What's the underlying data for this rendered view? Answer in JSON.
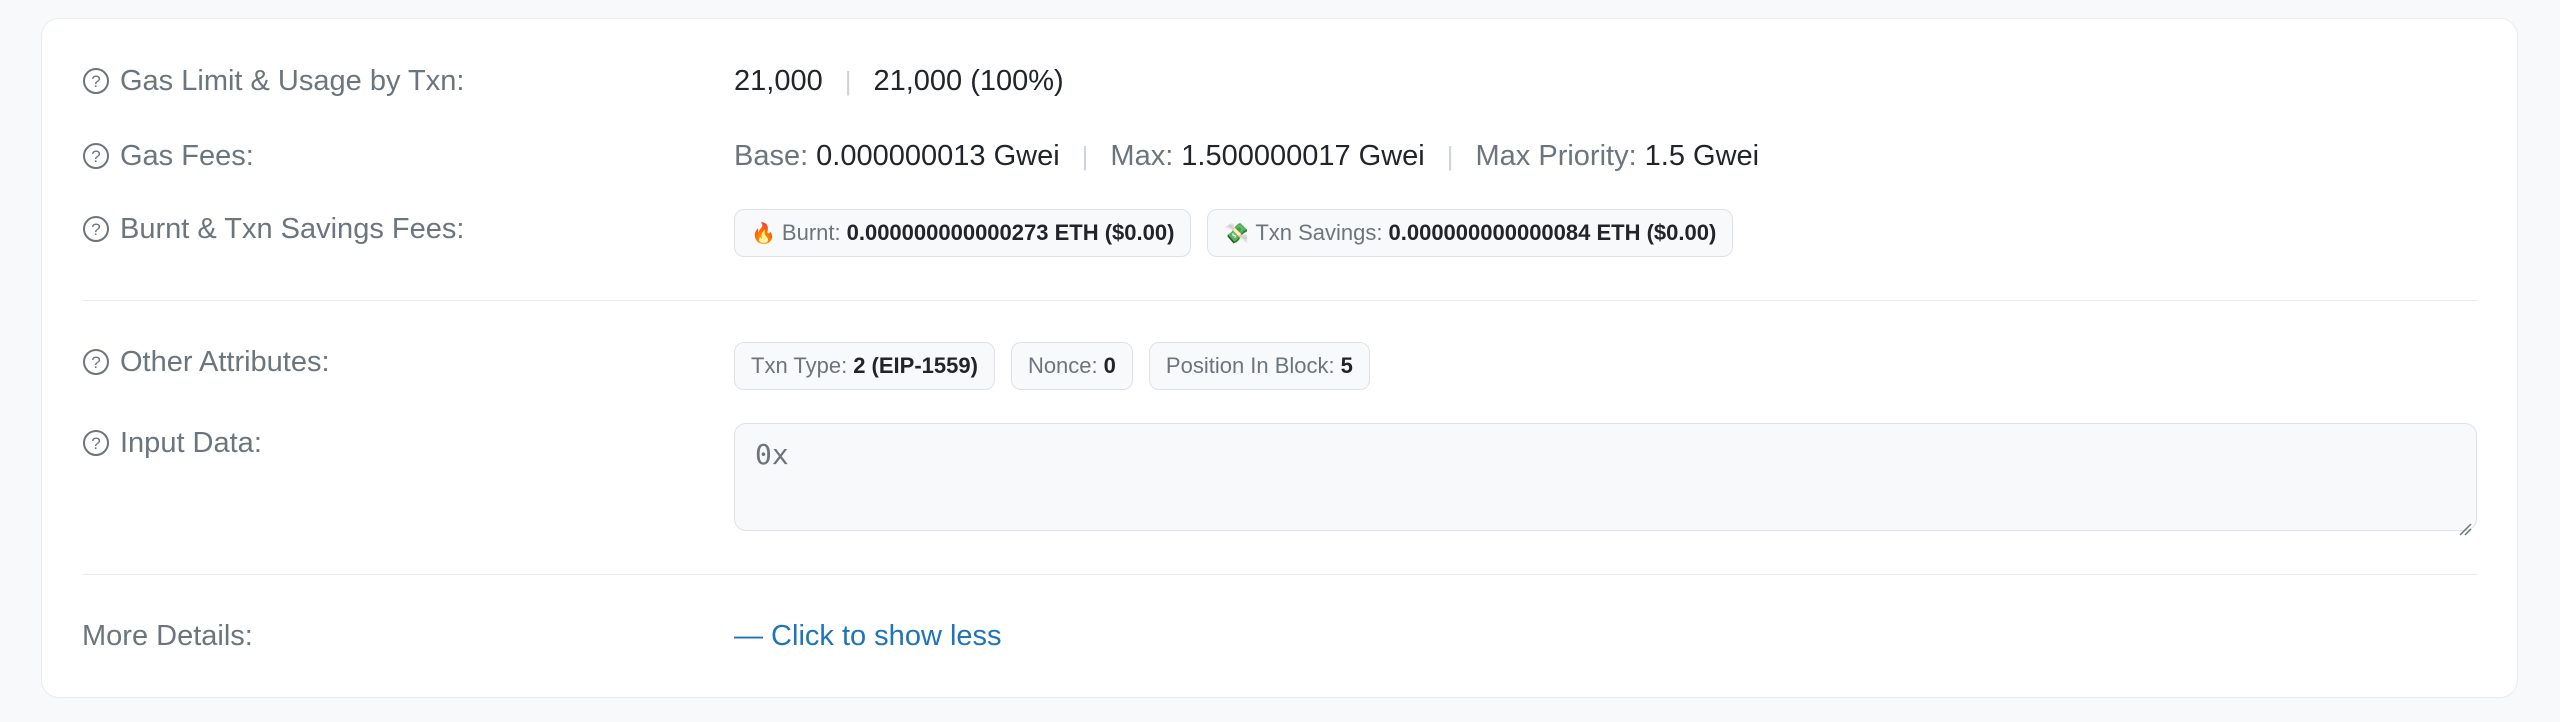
{
  "rows": {
    "gas_limit": {
      "label": "Gas Limit & Usage by Txn:",
      "limit": "21,000",
      "usage": "21,000 (100%)"
    },
    "gas_fees": {
      "label": "Gas Fees:",
      "base_label": "Base:",
      "base_value": "0.000000013 Gwei",
      "max_label": "Max:",
      "max_value": "1.500000017 Gwei",
      "priority_label": "Max Priority:",
      "priority_value": "1.5 Gwei"
    },
    "burnt": {
      "label": "Burnt & Txn Savings Fees:",
      "burnt_emoji": "🔥",
      "burnt_label": "Burnt:",
      "burnt_value": "0.000000000000273 ETH ($0.00)",
      "savings_emoji": "💸",
      "savings_label": "Txn Savings:",
      "savings_value": "0.000000000000084 ETH ($0.00)"
    },
    "other": {
      "label": "Other Attributes:",
      "txn_type_label": "Txn Type:",
      "txn_type_value": "2 (EIP-1559)",
      "nonce_label": "Nonce:",
      "nonce_value": "0",
      "position_label": "Position In Block:",
      "position_value": "5"
    },
    "input": {
      "label": "Input Data:",
      "value": "0x"
    },
    "more": {
      "label": "More Details:",
      "link": "— Click to show less"
    }
  },
  "colors": {
    "link": "#1e74b9",
    "muted": "#6c757d",
    "border": "#dee2e6"
  },
  "icons": {
    "help": "question-circle-icon"
  }
}
